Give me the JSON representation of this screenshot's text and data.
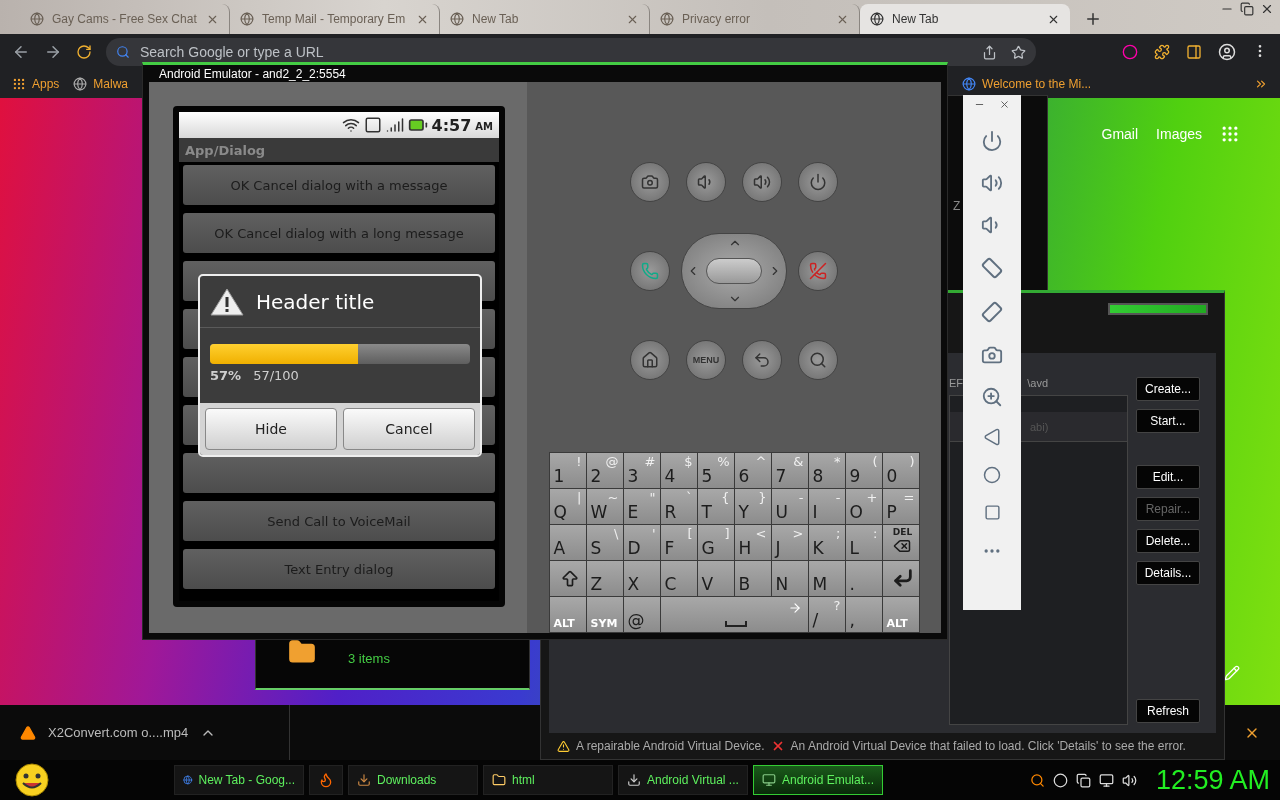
{
  "browser": {
    "tabs": [
      {
        "title": "Gay Cams - Free Sex Chat",
        "selected": false
      },
      {
        "title": "Temp Mail - Temporary Em",
        "selected": false
      },
      {
        "title": "New Tab",
        "selected": false
      },
      {
        "title": "Privacy error",
        "selected": false
      },
      {
        "title": "New Tab",
        "selected": true
      }
    ],
    "address": {
      "placeholder": "Search Google or type a URL"
    },
    "bookmarks": [
      {
        "label": "Apps"
      },
      {
        "label": "Malwa"
      }
    ],
    "bookmark_right": "Welcome to the Mi...",
    "links": [
      "Gmail",
      "Images"
    ],
    "download": {
      "file": "X2Convert.com o....mp4"
    }
  },
  "explorer": {
    "status": "3 items"
  },
  "small_window": {
    "fragment": "Z"
  },
  "avd_manager": {
    "path_left": "EF",
    "path_right": "\\avd",
    "row_fragment": "abi)",
    "buttons": [
      {
        "label": "Create...",
        "disabled": false
      },
      {
        "label": "Start...",
        "disabled": false
      },
      {
        "label": "Edit...",
        "disabled": false
      },
      {
        "label": "Repair...",
        "disabled": true
      },
      {
        "label": "Delete...",
        "disabled": false
      },
      {
        "label": "Details...",
        "disabled": false
      }
    ],
    "refresh": "Refresh",
    "legend": [
      "A repairable Android Virtual Device.",
      "An Android Virtual Device that failed to load. Click 'Details' to see the error."
    ]
  },
  "emulator": {
    "title": "Android Emulator - and2_2_2:5554",
    "phone": {
      "time": "4:57",
      "ampm": "AM",
      "app_title": "App/Dialog",
      "list_items": [
        "OK Cancel dialog with a message",
        "OK Cancel dialog with a long message",
        "Send Call to VoiceMail",
        "Text Entry dialog"
      ],
      "dialog": {
        "title": "Header title",
        "progress": {
          "level": 0.57
        },
        "percent": "57%",
        "count": "57/100",
        "buttons": [
          "Hide",
          "Cancel"
        ]
      }
    },
    "menu_key": "MENU",
    "keyboard": [
      [
        {
          "kind": "char",
          "main": "1",
          "alt": "!"
        },
        {
          "kind": "char",
          "main": "2",
          "alt": "@"
        },
        {
          "kind": "char",
          "main": "3",
          "alt": "#"
        },
        {
          "kind": "char",
          "main": "4",
          "alt": "$"
        },
        {
          "kind": "char",
          "main": "5",
          "alt": "%"
        },
        {
          "kind": "char",
          "main": "6",
          "alt": "^"
        },
        {
          "kind": "char",
          "main": "7",
          "alt": "&"
        },
        {
          "kind": "char",
          "main": "8",
          "alt": "*"
        },
        {
          "kind": "char",
          "main": "9",
          "alt": "("
        },
        {
          "kind": "char",
          "main": "0",
          "alt": ")"
        }
      ],
      [
        {
          "kind": "char",
          "main": "Q",
          "alt": "|"
        },
        {
          "kind": "char",
          "main": "W",
          "alt": "~"
        },
        {
          "kind": "char",
          "main": "E",
          "alt": "\""
        },
        {
          "kind": "char",
          "main": "R",
          "alt": "`"
        },
        {
          "kind": "char",
          "main": "T",
          "alt": "{"
        },
        {
          "kind": "char",
          "main": "Y",
          "alt": "}"
        },
        {
          "kind": "char",
          "main": "U",
          "alt": "-"
        },
        {
          "kind": "char",
          "main": "I",
          "alt": "-"
        },
        {
          "kind": "char",
          "main": "O",
          "alt": "+"
        },
        {
          "kind": "char",
          "main": "P",
          "alt": "="
        }
      ],
      [
        {
          "kind": "char",
          "main": "A"
        },
        {
          "kind": "char",
          "main": "S",
          "alt": "\\"
        },
        {
          "kind": "char",
          "main": "D",
          "alt": "'"
        },
        {
          "kind": "char",
          "main": "F",
          "alt": "["
        },
        {
          "kind": "char",
          "main": "G",
          "alt": "]"
        },
        {
          "kind": "char",
          "main": "H",
          "alt": "<"
        },
        {
          "kind": "char",
          "main": "J",
          "alt": ">"
        },
        {
          "kind": "char",
          "main": "K",
          "alt": ";"
        },
        {
          "kind": "char",
          "main": "L",
          "alt": ":"
        },
        {
          "kind": "del",
          "main": "DEL"
        }
      ],
      [
        {
          "kind": "shift"
        },
        {
          "kind": "char",
          "main": "Z"
        },
        {
          "kind": "char",
          "main": "X"
        },
        {
          "kind": "char",
          "main": "C"
        },
        {
          "kind": "char",
          "main": "V"
        },
        {
          "kind": "char",
          "main": "B"
        },
        {
          "kind": "char",
          "main": "N"
        },
        {
          "kind": "char",
          "main": "M"
        },
        {
          "kind": "char",
          "main": "."
        },
        {
          "kind": "enter"
        }
      ],
      [
        {
          "kind": "mod",
          "main": "ALT"
        },
        {
          "kind": "mod",
          "main": "SYM"
        },
        {
          "kind": "char",
          "main": "@"
        },
        {
          "kind": "space"
        },
        {
          "kind": "char",
          "main": "/",
          "alt": "?"
        },
        {
          "kind": "char",
          "main": ","
        },
        {
          "kind": "mod",
          "main": "ALT"
        }
      ]
    ]
  },
  "taskbar": {
    "items": [
      {
        "label": "New Tab - Goog...",
        "selected": false
      },
      {
        "selected": false
      },
      {
        "label": "Downloads",
        "selected": false
      },
      {
        "label": "html",
        "selected": false
      },
      {
        "label": "Android Virtual ...",
        "selected": false
      },
      {
        "label": "Android Emulat...",
        "selected": true
      }
    ],
    "clock": "12:59 AM"
  }
}
